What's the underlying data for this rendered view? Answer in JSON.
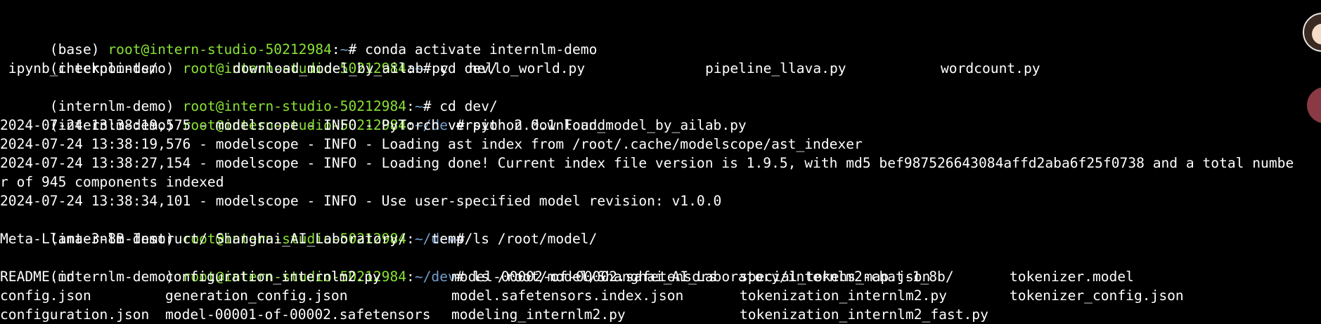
{
  "terminal": {
    "prompt": {
      "user_host": "root@intern-studio-50212984",
      "sep": ":",
      "home": "~",
      "dev": "/dev",
      "hash": "# "
    },
    "lines": {
      "l1_env": "(base) ",
      "l1_cmd": "conda activate internlm-demo",
      "l2_env": "(internlm-demo) ",
      "l2_cmd": "cd dev/",
      "l3_c1": " ipynb_checkpoints/",
      "l3_c2": "download_model_by_ailab.py",
      "l3_c3": "hello_world.py",
      "l3_c4": "pipeline_llava.py",
      "l3_c5": "wordcount.py",
      "l4_env": "(internlm-demo) ",
      "l4_cmd": "cd dev/",
      "l5_env": "(internlm-demo) ",
      "l5_cmd": "python download_model_by_ailab.py",
      "l6": "2024-07-24 13:38:19,575 - modelscope - INFO - PyTorch version 2.0.1 Found.",
      "l7": "2024-07-24 13:38:19,576 - modelscope - INFO - Loading ast index from /root/.cache/modelscope/ast_indexer",
      "l8": "2024-07-24 13:38:27,154 - modelscope - INFO - Loading done! Current index file version is 1.9.5, with md5 bef987526643084affd2aba6f25f0738 and a total numbe",
      "l9": "r of 945 components indexed",
      "l10": "2024-07-24 13:38:34,101 - modelscope - INFO - Use user-specified model revision: v1.0.0",
      "l11_env": "(internlm-demo) ",
      "l11_cmd": "ls /root/model/",
      "l12": "Meta-Llama-3-8B-Instruct/ Shanghai_AI_Laboratory/   temp/",
      "l13_env": "(internlm-demo) ",
      "l13_cmd": "ls /root/model/Shanghai_AI_Laboratory/internlm2-chat-1_8b/",
      "l14_c1": "README.md",
      "l14_c2": "configuration_internlm2.py",
      "l14_c3": "model-00002-of-00002.safetensors",
      "l14_c4": "special_tokens_map.json",
      "l14_c5": "tokenizer.model",
      "l15_c1": "config.json",
      "l15_c2": "generation_config.json",
      "l15_c3": "model.safetensors.index.json",
      "l15_c4": "tokenization_internlm2.py",
      "l15_c5": "tokenizer_config.json",
      "l16_c1": "configuration.json",
      "l16_c2": "model-00001-of-00002.safetensors",
      "l16_c3": "modeling_internlm2.py",
      "l16_c4": "tokenization_internlm2_fast.py"
    }
  },
  "colors": {
    "background": "#000000",
    "text": "#ffffff",
    "user_host": "#8ae234",
    "path": "#729fcf"
  },
  "icons": {
    "avatar": "user-avatar-icon",
    "side_button": "side-action-icon"
  }
}
